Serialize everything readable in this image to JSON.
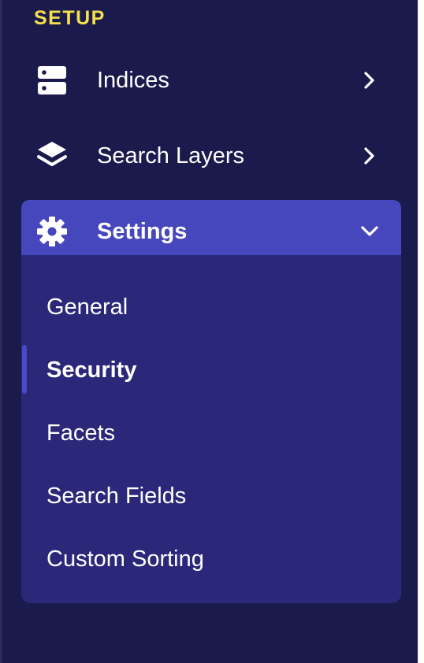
{
  "sidebar": {
    "section_title": "SETUP",
    "items": [
      {
        "label": "Indices",
        "icon": "server-icon",
        "expanded": false
      },
      {
        "label": "Search Layers",
        "icon": "layers-icon",
        "expanded": false
      },
      {
        "label": "Settings",
        "icon": "gear-icon",
        "expanded": true
      }
    ],
    "settings_submenu": [
      {
        "label": "General",
        "active": false
      },
      {
        "label": "Security",
        "active": true
      },
      {
        "label": "Facets",
        "active": false
      },
      {
        "label": "Search Fields",
        "active": false
      },
      {
        "label": "Custom Sorting",
        "active": false
      }
    ]
  },
  "colors": {
    "background": "#1b1a4d",
    "section_title": "#f5e04b",
    "active_item": "#4747bd",
    "submenu_background": "#2b287a",
    "text": "#ffffff"
  }
}
